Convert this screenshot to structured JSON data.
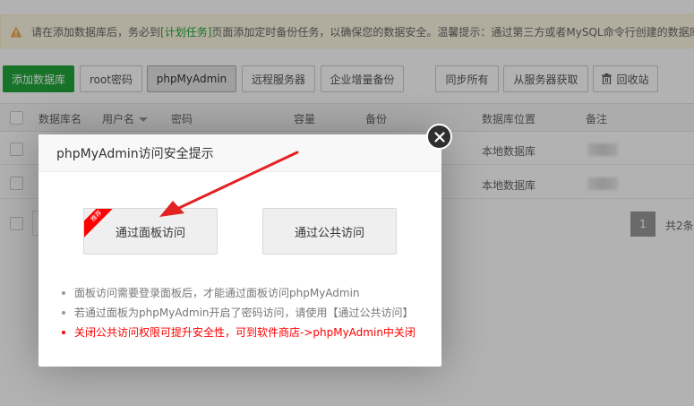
{
  "notice": {
    "text_before": "请在添加数据库后，务必到",
    "link": "[计划任务]",
    "text_after": "页面添加定时备份任务，以确保您的数据安全。温馨提示：通过第三方或者MySQL命令行创建的数据库"
  },
  "toolbar": {
    "add_db": "添加数据库",
    "root_pwd": "root密码",
    "phpmyadmin": "phpMyAdmin",
    "remote_server": "远程服务器",
    "enterprise_backup": "企业增量备份",
    "sync_all": "同步所有",
    "fetch_from_server": "从服务器获取",
    "recycle_bin": "回收站"
  },
  "table": {
    "headers": [
      "数据库名",
      "用户名",
      "密码",
      "容量",
      "备份",
      "数据库位置",
      "备注"
    ],
    "rows": [
      {
        "location": "本地数据库"
      },
      {
        "location": "本地数据库"
      }
    ]
  },
  "pagination": {
    "current_page": "1",
    "total": "共2条"
  },
  "dialog": {
    "title": "phpMyAdmin访问安全提示",
    "panel_access": "通过面板访问",
    "public_access": "通过公共访问",
    "badge": "推荐",
    "tips": [
      "面板访问需要登录面板后，才能通过面板访问phpMyAdmin",
      "若通过面板为phpMyAdmin开启了密码访问，请使用【通过公共访问】",
      "关闭公共访问权限可提升安全性，可到软件商店->phpMyAdmin中关闭"
    ]
  },
  "colors": {
    "brand_green": "#20a53a",
    "alert_red": "#ff0000",
    "notice_bg": "#fcf8e3"
  }
}
